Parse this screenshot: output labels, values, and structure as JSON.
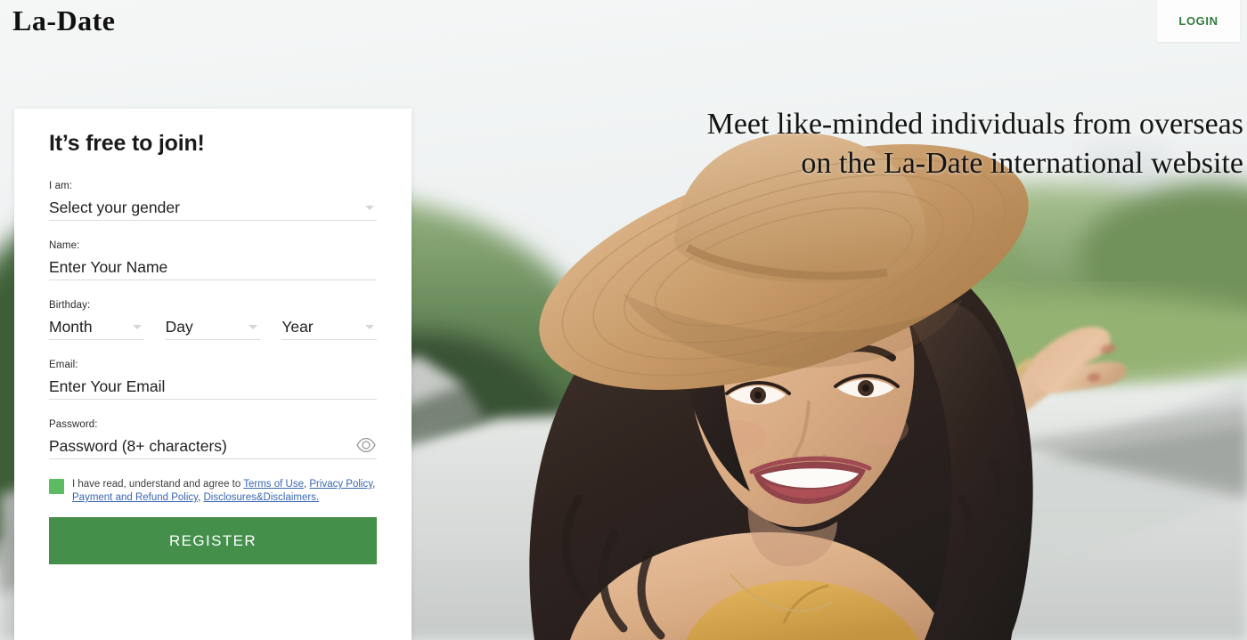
{
  "header": {
    "logo": "La-Date",
    "login_label": "LOGIN"
  },
  "hero": {
    "headline_line1": "Meet like-minded individuals from overseas",
    "headline_line2": "on the La-Date international website",
    "photo_alt": "Smiling woman wearing a straw hat outdoors with arm outstretched"
  },
  "form": {
    "title": "It’s free to join!",
    "gender": {
      "label": "I am:",
      "value": "Select your gender"
    },
    "name": {
      "label": "Name:",
      "placeholder": "Enter Your Name",
      "value": ""
    },
    "birthday": {
      "label": "Birthday:",
      "month": "Month",
      "day": "Day",
      "year": "Year"
    },
    "email": {
      "label": "Email:",
      "placeholder": "Enter Your Email",
      "value": ""
    },
    "password": {
      "label": "Password:",
      "placeholder": "Password (8+ characters)",
      "value": ""
    },
    "terms": {
      "checked": true,
      "intro": "I have read, understand and agree to ",
      "link1": "Terms of Use",
      "sep1": ", ",
      "link2": "Privacy Policy",
      "sep2": ", ",
      "link3": "Payment and Refund Policy",
      "sep3": ", ",
      "link4": "Disclosures&Disclaimers."
    },
    "submit_label": "REGISTER"
  },
  "colors": {
    "brand_green": "#44904b",
    "checkbox_green": "#5cbb63",
    "login_green": "#2f7d39",
    "link_blue": "#3a66b0",
    "page_bg": "#f1f3f4"
  }
}
